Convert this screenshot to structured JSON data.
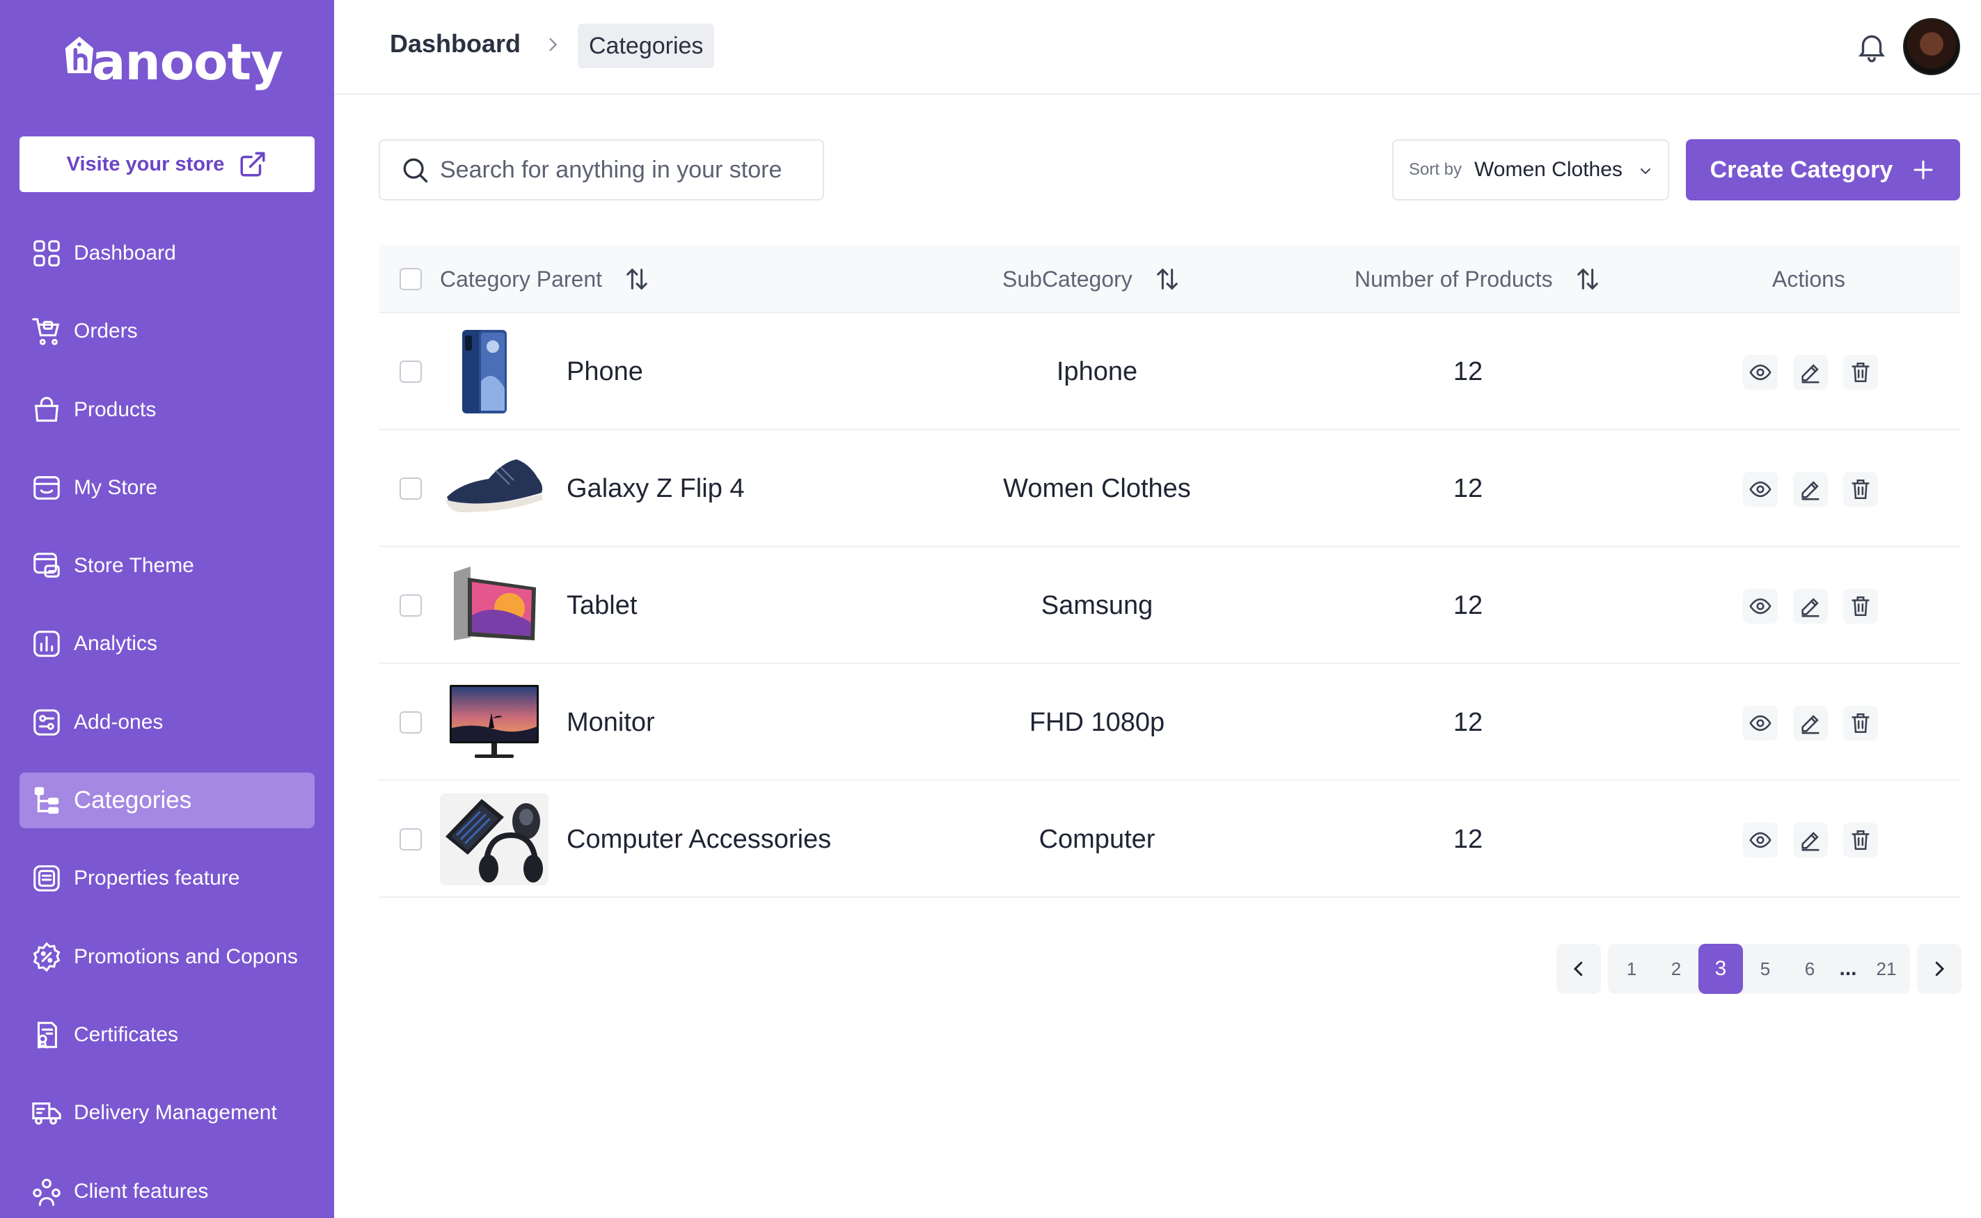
{
  "brand": {
    "logo_text": "anooty"
  },
  "sidebar": {
    "visit_label": "Visite your store",
    "items": [
      {
        "label": "Dashboard"
      },
      {
        "label": "Orders"
      },
      {
        "label": "Products"
      },
      {
        "label": "My Store"
      },
      {
        "label": "Store Theme"
      },
      {
        "label": "Analytics"
      },
      {
        "label": "Add-ones"
      },
      {
        "label": "Categories"
      },
      {
        "label": "Properties feature"
      },
      {
        "label": "Promotions and Copons"
      },
      {
        "label": "Certificates"
      },
      {
        "label": "Delivery Management"
      },
      {
        "label": "Client features"
      }
    ]
  },
  "header": {
    "breadcrumb_root": "Dashboard",
    "breadcrumb_current": "Categories"
  },
  "toolbar": {
    "search_placeholder": "Search for anything in your store",
    "sort_label": "Sort by",
    "sort_value": "Women Clothes",
    "create_label": "Create Category"
  },
  "table": {
    "columns": [
      "Category Parent",
      "SubCategory",
      "Number of Products",
      "Actions"
    ],
    "rows": [
      {
        "name": "Phone",
        "sub": "Iphone",
        "count": "12"
      },
      {
        "name": "Galaxy Z Flip 4",
        "sub": "Women Clothes",
        "count": "12"
      },
      {
        "name": "Tablet",
        "sub": "Samsung",
        "count": "12"
      },
      {
        "name": "Monitor",
        "sub": "FHD 1080p",
        "count": "12"
      },
      {
        "name": "Computer Accessories",
        "sub": "Computer",
        "count": "12"
      }
    ]
  },
  "pagination": {
    "pages": [
      "1",
      "2",
      "3",
      "5",
      "6",
      "...",
      "21"
    ],
    "current": "3"
  },
  "colors": {
    "accent": "#7b57d1",
    "sidebar_active": "#a488e3"
  }
}
